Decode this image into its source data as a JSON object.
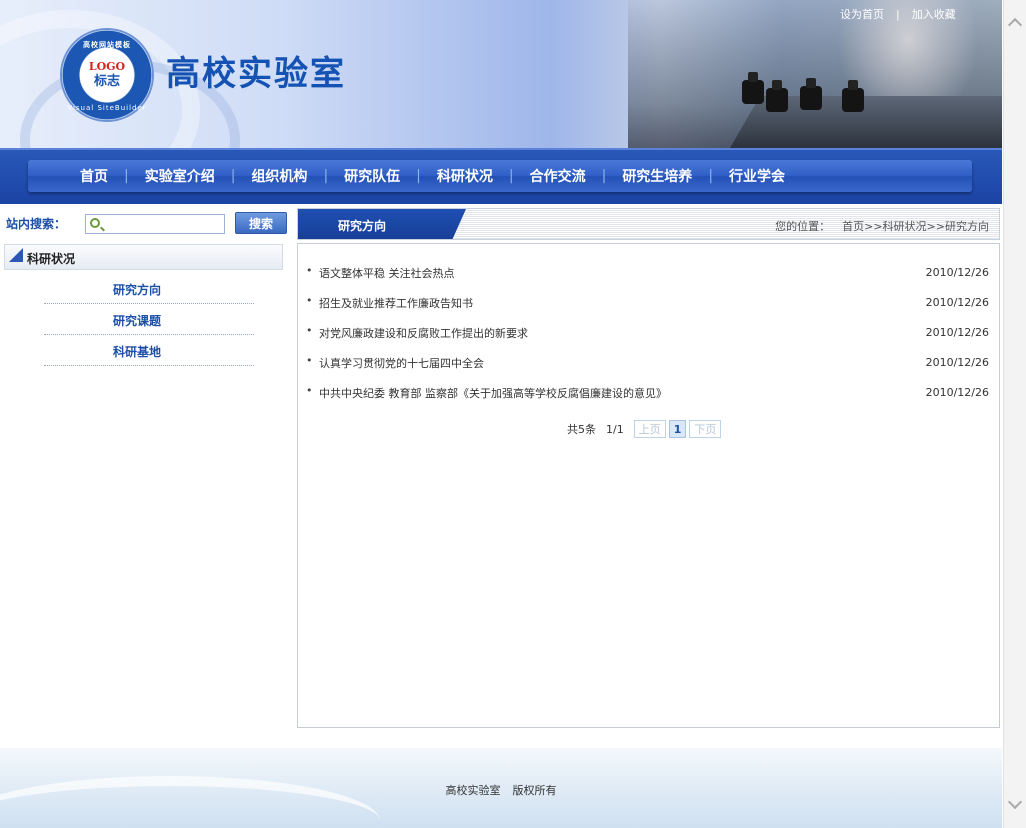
{
  "header": {
    "site_title": "高校实验室",
    "logo": {
      "ring_text": "高校网站模板",
      "ring_text_bottom": "Visual SiteBuilder",
      "word": "LOGO",
      "cn": "标志"
    },
    "top_links": [
      "设为首页",
      "加入收藏"
    ]
  },
  "nav": {
    "items": [
      "首页",
      "实验室介绍",
      "组织机构",
      "研究队伍",
      "科研状况",
      "合作交流",
      "研究生培养",
      "行业学会"
    ]
  },
  "search": {
    "label": "站内搜索：",
    "placeholder": "",
    "button": "搜索"
  },
  "sidebar": {
    "title": "科研状况",
    "items": [
      "研究方向",
      "研究课题",
      "科研基地"
    ]
  },
  "main": {
    "tab_title": "研究方向",
    "breadcrumb_label": "您的位置：",
    "breadcrumb": "首页>>科研状况>>研究方向",
    "news": [
      {
        "title": "语文整体平稳 关注社会热点",
        "date": "2010/12/26"
      },
      {
        "title": "招生及就业推荐工作廉政告知书",
        "date": "2010/12/26"
      },
      {
        "title": "对党风廉政建设和反腐败工作提出的新要求",
        "date": "2010/12/26"
      },
      {
        "title": "认真学习贯彻党的十七届四中全会",
        "date": "2010/12/26"
      },
      {
        "title": "中共中央纪委 教育部 监察部《关于加强高等学校反腐倡廉建设的意见》",
        "date": "2010/12/26"
      }
    ],
    "pager": {
      "total": "共5条",
      "page_info": "1/1",
      "prev": "上页",
      "current": "1",
      "next": "下页"
    }
  },
  "footer": {
    "text": "高校实验室",
    "copyright": "版权所有"
  },
  "colors": {
    "brand": "#1b4fa8",
    "nav": "#2451b6"
  }
}
